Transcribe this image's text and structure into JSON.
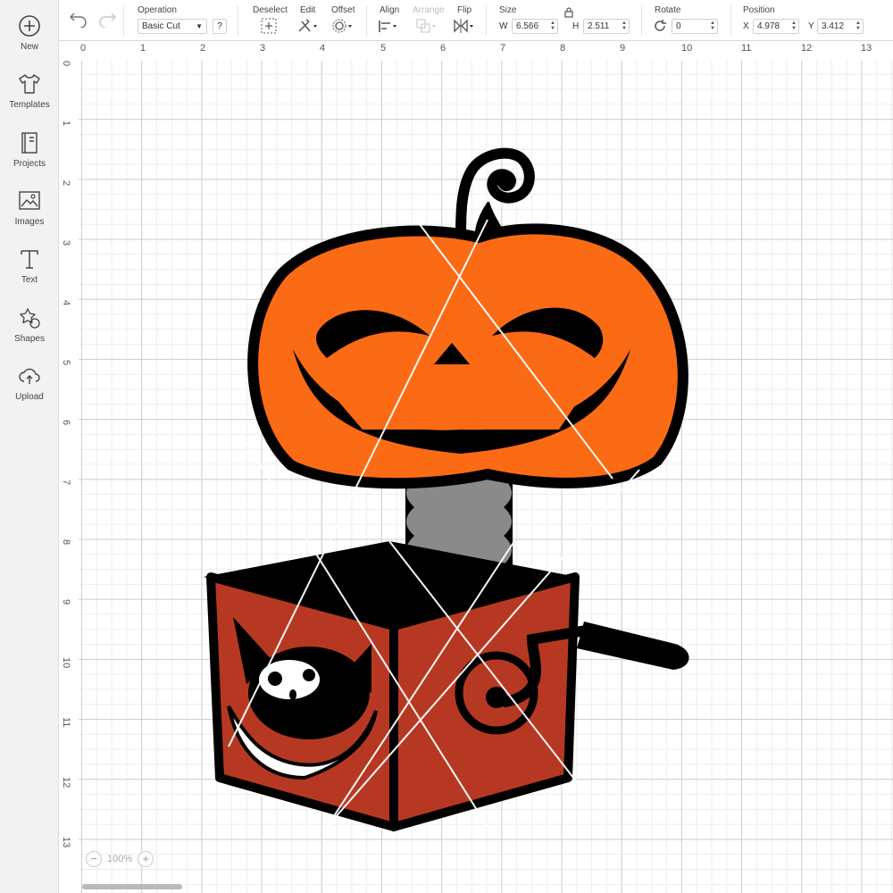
{
  "sidebar": {
    "items": [
      {
        "label": "New",
        "icon": "plus-circle-icon"
      },
      {
        "label": "Templates",
        "icon": "tshirt-icon"
      },
      {
        "label": "Projects",
        "icon": "projects-icon"
      },
      {
        "label": "Images",
        "icon": "image-icon"
      },
      {
        "label": "Text",
        "icon": "text-icon"
      },
      {
        "label": "Shapes",
        "icon": "shapes-icon"
      },
      {
        "label": "Upload",
        "icon": "upload-icon"
      }
    ]
  },
  "toolbar": {
    "operation_title": "Operation",
    "operation_value": "Basic Cut",
    "help_label": "?",
    "deselect_title": "Deselect",
    "edit_title": "Edit",
    "offset_title": "Offset",
    "align_title": "Align",
    "arrange_title": "Arrange",
    "flip_title": "Flip",
    "size_title": "Size",
    "width_label": "W",
    "width_value": "6.566",
    "height_label": "H",
    "height_value": "2.511",
    "rotate_title": "Rotate",
    "rotate_value": "0",
    "position_title": "Position",
    "x_label": "X",
    "x_value": "4.978",
    "y_label": "Y",
    "y_value": "3.412"
  },
  "ruler": {
    "top": [
      "0",
      "1",
      "2",
      "3",
      "4",
      "5",
      "6",
      "7",
      "8",
      "9",
      "10",
      "11",
      "12",
      "13"
    ],
    "left": [
      "0",
      "1",
      "2",
      "3",
      "4",
      "5",
      "6",
      "7",
      "8",
      "9",
      "10",
      "11",
      "12",
      "13"
    ]
  },
  "zoom": {
    "minus": "−",
    "value": "100%",
    "plus": "+"
  },
  "colors": {
    "pumpkin": "#fb6a14",
    "box_red": "#b73822",
    "spring_gray": "#8a8a8a",
    "outline": "#000000",
    "grid_major": "#cfcfcf",
    "grid_minor": "#ececec"
  }
}
